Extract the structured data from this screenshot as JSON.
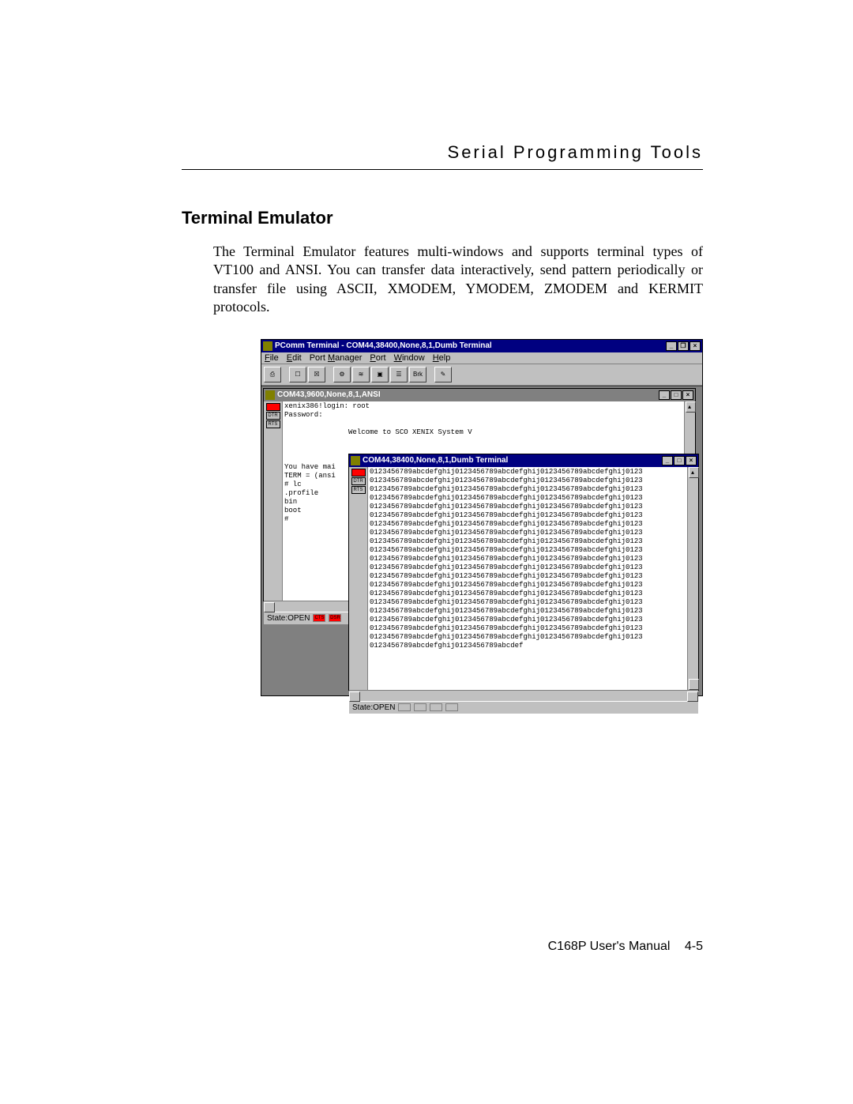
{
  "header": {
    "chapter": "Serial Programming Tools"
  },
  "section": {
    "title": "Terminal Emulator",
    "body": "The Terminal Emulator features multi-windows and supports terminal types of VT100 and ANSI. You can transfer data interactively, send pattern periodically or transfer file using ASCII, XMODEM, YMODEM, ZMODEM and KERMIT protocols."
  },
  "app": {
    "title": "PComm Terminal - COM44,38400,None,8,1,Dumb Terminal",
    "menu": {
      "file": "File",
      "edit": "Edit",
      "port_manager": "Port Manager",
      "port": "Port",
      "window": "Window",
      "help": "Help"
    },
    "toolbar": {
      "brk_label": "Brk"
    },
    "child1": {
      "title": "COM43,9600,None,8,1,ANSI",
      "indicators": {
        "dtr": "DTR",
        "rts": "RTS"
      },
      "content": "xenix386!login: root\nPassword:\n\n               Welcome to SCO XENIX System V\n\n\n\nYou have mai\nTERM = (ansi\n# lc\n.profile\nbin\nboot\n#",
      "status_label": "State:OPEN",
      "status_leds": {
        "cts": "CTS",
        "dsr": "DSR"
      }
    },
    "child2": {
      "title": "COM44,38400,None,8,1,Dumb Terminal",
      "indicators": {
        "dtr": "DTR",
        "rts": "RTS"
      },
      "line_full": "0123456789abcdefghij0123456789abcdefghij0123456789abcdefghij0123",
      "line_last": "0123456789abcdefghij0123456789abcdef",
      "status_label": "State:OPEN"
    }
  },
  "footer": {
    "manual": "C168P User's Manual",
    "page": "4-5"
  }
}
